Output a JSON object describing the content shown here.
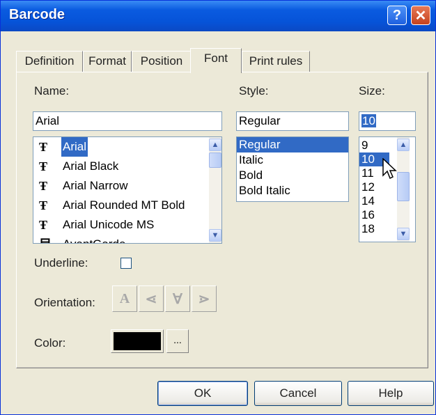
{
  "window": {
    "title": "Barcode",
    "help_label": "?",
    "close_label": "✕"
  },
  "tabs": [
    {
      "label": "Definition"
    },
    {
      "label": "Format"
    },
    {
      "label": "Position"
    },
    {
      "label": "Font"
    },
    {
      "label": "Print rules"
    }
  ],
  "active_tab": "Font",
  "name": {
    "label": "Name:",
    "value": "Arial",
    "items": [
      {
        "label": "Arial",
        "icon": "truetype-icon",
        "glyph": "Ŧ"
      },
      {
        "label": "Arial Black",
        "icon": "truetype-icon",
        "glyph": "Ŧ"
      },
      {
        "label": "Arial Narrow",
        "icon": "truetype-icon",
        "glyph": "Ŧ"
      },
      {
        "label": "Arial Rounded MT Bold",
        "icon": "truetype-icon",
        "glyph": "Ŧ"
      },
      {
        "label": "Arial Unicode MS",
        "icon": "truetype-icon",
        "glyph": "Ŧ"
      },
      {
        "label": "AvantGarde",
        "icon": "printer-font-icon",
        "glyph": "目"
      }
    ],
    "selected": "Arial"
  },
  "style": {
    "label": "Style:",
    "value": "Regular",
    "items": [
      "Regular",
      "Italic",
      "Bold",
      "Bold Italic"
    ],
    "selected": "Regular"
  },
  "size": {
    "label": "Size:",
    "value": "10",
    "items": [
      "9",
      "10",
      "11",
      "12",
      "14",
      "16",
      "18"
    ],
    "selected": "10"
  },
  "underline": {
    "label": "Underline:",
    "checked": false
  },
  "orientation": {
    "label": "Orientation:",
    "glyphs": [
      "A",
      "⋖",
      "∀",
      "⋗"
    ]
  },
  "color": {
    "label": "Color:",
    "value": "#000000",
    "button_label": "..."
  },
  "buttons": {
    "ok": "OK",
    "cancel": "Cancel",
    "help": "Help"
  },
  "colors": {
    "titlebar": "#0653D8",
    "selection": "#316AC5",
    "dialog_bg": "#ECE9D8"
  }
}
